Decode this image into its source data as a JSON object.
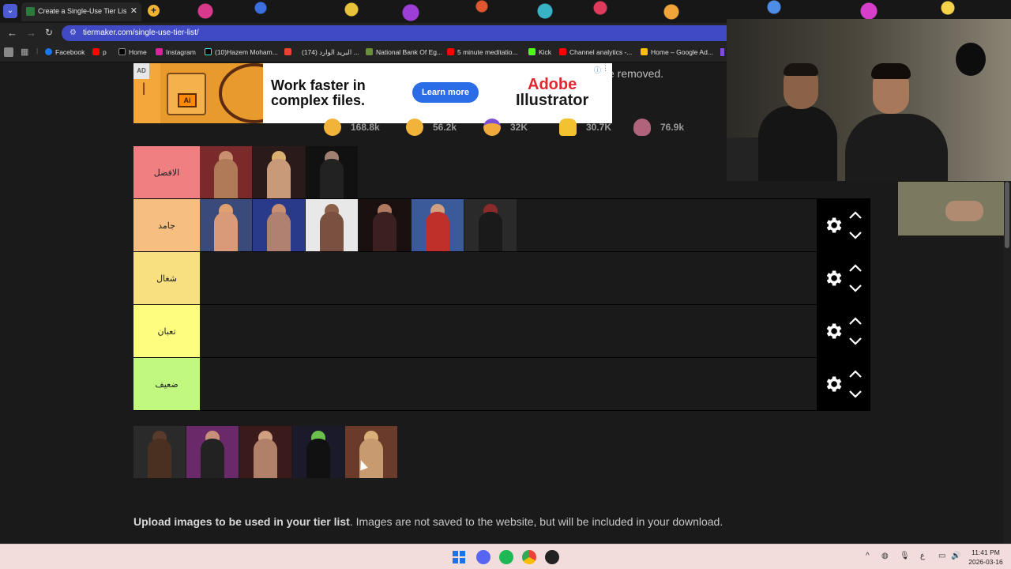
{
  "browser": {
    "tab_title": "Create a Single-Use Tier List (P",
    "tab_close": "✕",
    "new_tab": "+",
    "url": "tiermaker.com/single-use-tier-list/",
    "bookmarks": [
      {
        "label": "Facebook",
        "color": "#1877f2"
      },
      {
        "label": "p",
        "color": "#ff0000"
      },
      {
        "label": "Home",
        "color": "#ffffff"
      },
      {
        "label": "Instagram",
        "color": "#d6249f"
      },
      {
        "label": "(10)Hazem Moham...",
        "color": "#ffffff"
      },
      {
        "label": "",
        "color": "#ea4335"
      },
      {
        "label": "(174) البريد الوارد ...",
        "color": "#ffffff"
      },
      {
        "label": "National Bank Of Eg...",
        "color": "#6a8f3a"
      },
      {
        "label": "5 minute meditatio...",
        "color": "#ff0000"
      },
      {
        "label": "Kick",
        "color": "#53fc18"
      },
      {
        "label": "Channel analytics -...",
        "color": "#ff0000"
      },
      {
        "label": "Home – Google Ad...",
        "color": "#fbbc04"
      }
    ]
  },
  "page": {
    "removed_text": "e removed.",
    "ad": {
      "badge": "AD",
      "headline_line1": "Work faster in",
      "headline_line2": "complex files.",
      "cta": "Learn more",
      "brand_line1": "Adobe",
      "brand_line2": "Illustrator",
      "ai_label": "Ai"
    },
    "reactions": [
      {
        "count": "168.8k",
        "color": "#f2b33a"
      },
      {
        "count": "56.2k",
        "color": "#f2b33a"
      },
      {
        "count": "32K",
        "color": "#f0a93a"
      },
      {
        "count": "30.7K",
        "color": "#f2c230"
      },
      {
        "count": "76.9k",
        "color": "#b0637a"
      }
    ],
    "tiers": [
      {
        "label": "الافضل",
        "color": "#f07f81",
        "cards": 3
      },
      {
        "label": "جامد",
        "color": "#f6bf7f",
        "cards": 6
      },
      {
        "label": "شغال",
        "color": "#f8df7f",
        "cards": 0
      },
      {
        "label": "تعبان",
        "color": "#fefd80",
        "cards": 0
      },
      {
        "label": "ضعيف",
        "color": "#c0f880",
        "cards": 0
      }
    ],
    "pool_count": 5,
    "upload_bold": "Upload images to be used in your tier list",
    "upload_rest": ". Images are not saved to the website, but will be included in your download."
  },
  "taskbar": {
    "time": "11:41 PM",
    "date": "2026-03-16",
    "lang": "ع",
    "tray_up": "^"
  }
}
